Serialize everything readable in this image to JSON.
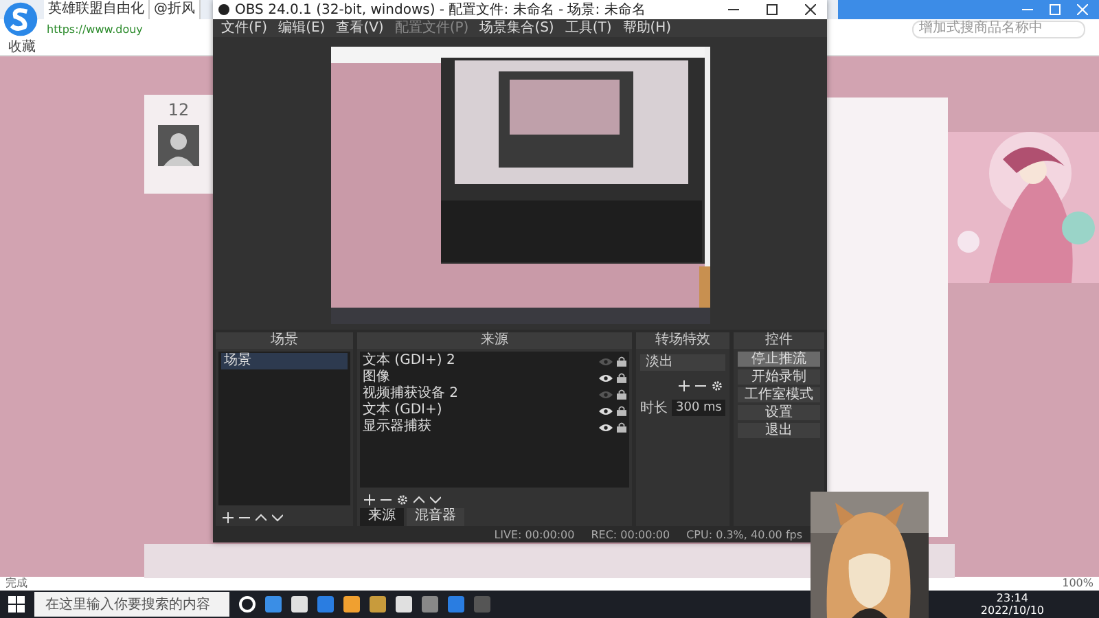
{
  "browser": {
    "tabs": [
      {
        "title": "英雄联盟自由化"
      },
      {
        "title": "@折风"
      }
    ],
    "url": "https://www.douy",
    "search_placeholder": "增加式搜商品名称中",
    "bookmarks": [
      "收藏"
    ],
    "room_count": "12",
    "status": "完成",
    "zoom": "100%"
  },
  "obs": {
    "title": "OBS 24.0.1 (32-bit, windows) - 配置文件: 未命名 - 场景: 未命名",
    "menu": [
      {
        "label": "文件(F)",
        "disabled": false
      },
      {
        "label": "编辑(E)",
        "disabled": false
      },
      {
        "label": "查看(V)",
        "disabled": false
      },
      {
        "label": "配置文件(P)",
        "disabled": true
      },
      {
        "label": "场景集合(S)",
        "disabled": false
      },
      {
        "label": "工具(T)",
        "disabled": false
      },
      {
        "label": "帮助(H)",
        "disabled": false
      }
    ],
    "scenes": {
      "title": "场景",
      "items": [
        {
          "name": "场景",
          "selected": true
        }
      ]
    },
    "sources": {
      "title": "来源",
      "items": [
        {
          "name": "文本 (GDI+) 2",
          "visible": false
        },
        {
          "name": "图像",
          "visible": true
        },
        {
          "name": "视频捕获设备 2",
          "visible": false
        },
        {
          "name": "文本 (GDI+)",
          "visible": true
        },
        {
          "name": "显示器捕获",
          "visible": true
        }
      ]
    },
    "transitions": {
      "title": "转场特效",
      "effect": "淡出",
      "duration_label": "时长",
      "duration": "300 ms"
    },
    "controls": {
      "title": "控件",
      "buttons": [
        {
          "label": "停止推流",
          "active": true
        },
        {
          "label": "开始录制",
          "active": false
        },
        {
          "label": "工作室模式",
          "active": false
        },
        {
          "label": "设置",
          "active": false
        },
        {
          "label": "退出",
          "active": false
        }
      ]
    },
    "dock_tabs": [
      {
        "label": "来源",
        "selected": true
      },
      {
        "label": "混音器",
        "selected": false
      }
    ],
    "status": [
      "LIVE: 00:00:00",
      "REC: 00:00:00",
      "CPU: 0.3%, 40.00 fps"
    ]
  },
  "taskbar": {
    "search_placeholder": "在这里输入你要搜索的内容",
    "time": "23:14",
    "date": "2022/10/10"
  }
}
